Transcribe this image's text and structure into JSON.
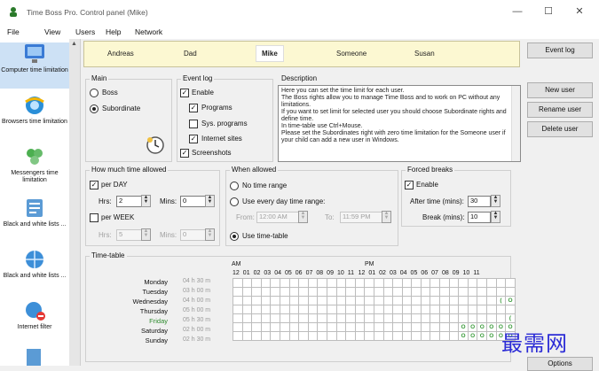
{
  "window": {
    "title": "Time Boss Pro. Control panel (Mike)",
    "minimize": "—",
    "maximize": "☐",
    "close": "✕"
  },
  "menu": [
    "File",
    "View",
    "Users",
    "Help",
    "Network"
  ],
  "sidebar": [
    {
      "label": "Computer time limitation",
      "icon": "monitor-icon",
      "selected": true
    },
    {
      "label": "Browsers time limitation",
      "icon": "browser-icon"
    },
    {
      "label": "Messengers time limitation",
      "icon": "messenger-icon"
    },
    {
      "label": "Black and white lists ...",
      "icon": "list-icon"
    },
    {
      "label": "Black and white lists ...",
      "icon": "globe-list-icon"
    },
    {
      "label": "Internet filter",
      "icon": "internet-filter-icon"
    }
  ],
  "users": [
    "Andreas",
    "Dad",
    "Mike",
    "Someone",
    "Susan"
  ],
  "selected_user": "Mike",
  "right_buttons": {
    "event_log": "Event log",
    "new_user": "New user",
    "rename_user": "Rename user",
    "delete_user": "Delete user",
    "options": "Options"
  },
  "main_group": {
    "title": "Main",
    "boss": "Boss",
    "subordinate": "Subordinate",
    "selected": "Subordinate"
  },
  "event_log_group": {
    "title": "Event log",
    "enable": "Enable",
    "programs": "Programs",
    "sys_programs": "Sys. programs",
    "internet_sites": "Internet sites",
    "screenshots": "Screenshots"
  },
  "description": {
    "title": "Description",
    "text": "Here you can set the time limit for each user.\nThe Boss rights allow you to manage Time Boss and to work on PC without any limitations.\nIf you want to set limit for selected user you should choose Subordinate rights and define time.\nIn time-table use Ctrl+Mouse.\nPlease set the Subordinates right with zero time limitation for the Someone user if your child can add a new user in Windows."
  },
  "time_allowed": {
    "title": "How much time allowed",
    "per_day": "per DAY",
    "per_week": "per WEEK",
    "hrs_label": "Hrs:",
    "mins_label": "Mins:",
    "day_hrs": "2",
    "day_mins": "0",
    "week_hrs": "5",
    "week_mins": "0"
  },
  "when_allowed": {
    "title": "When allowed",
    "no_time_range": "No time range",
    "every_day_range": "Use every day time range:",
    "from_label": "From:",
    "from": "12:00 AM",
    "to_label": "To:",
    "to": "11:59 PM",
    "use_timetable": "Use time-table",
    "selected": "Use time-table"
  },
  "forced_breaks": {
    "title": "Forced breaks",
    "enable": "Enable",
    "after_label": "After time (mins):",
    "after_value": "30",
    "break_label": "Break (mins):",
    "break_value": "10"
  },
  "timetable": {
    "title": "Time-table",
    "am": "AM",
    "pm": "PM",
    "hours": [
      "12",
      "01",
      "02",
      "03",
      "04",
      "05",
      "06",
      "07",
      "08",
      "09",
      "10",
      "11",
      "12",
      "01",
      "02",
      "03",
      "04",
      "05",
      "06",
      "07",
      "08",
      "09",
      "10",
      "11"
    ],
    "days": [
      {
        "name": "Monday",
        "duration": "04 h 30 m",
        "cells": "..............................(ooo)......"
      },
      {
        "name": "Tuesday",
        "duration": "03 h 00 m",
        "cells": "..............................(ooo)`....."
      },
      {
        "name": "Wednesday",
        "duration": "04 h 00 m",
        "cells": "............................(oooo)......."
      },
      {
        "name": "Thursday",
        "duration": "05 h 00 m",
        "cells": "..............................(ooo)......"
      },
      {
        "name": "Friday",
        "duration": "05 h 30 m",
        "cells": ".............................(ooo)......."
      },
      {
        "name": "Saturday",
        "duration": "02 h 00 m",
        "cells": "........................ooooooooooooooo.."
      },
      {
        "name": "Sunday",
        "duration": "02 h 30 m",
        "cells": "........................ooooooooooooooo.."
      }
    ],
    "friday_color": "#2e8b2e"
  },
  "watermark": "最需网"
}
